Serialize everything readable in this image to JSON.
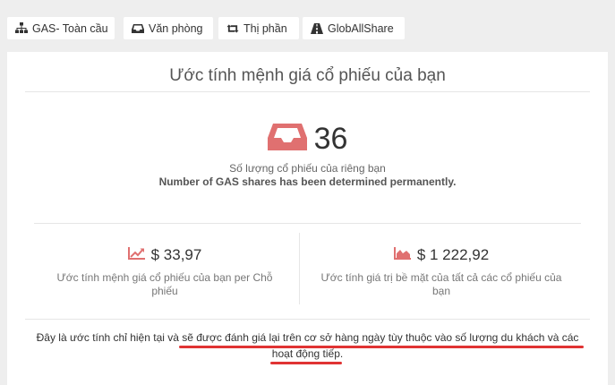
{
  "tabs": [
    {
      "label": "GAS- Toàn cầu",
      "icon": "sitemap-icon"
    },
    {
      "label": "Văn phòng",
      "icon": "inbox-icon"
    },
    {
      "label": "Thị phần",
      "icon": "retweet-icon"
    },
    {
      "label": "GlobAllShare",
      "icon": "road-icon"
    }
  ],
  "panel": {
    "title": "Ước tính mệnh giá cổ phiếu của bạn",
    "share_count": "36",
    "share_count_label": "Số lượng cổ phiếu của riêng bạn",
    "share_count_note": "Number of GAS shares has been determined permanently.",
    "stat_left": {
      "value": "$ 33,97",
      "label": "Ước tính mệnh giá cổ phiếu của bạn per Chỗ phiếu",
      "icon": "line-chart-icon"
    },
    "stat_right": {
      "value": "$ 1 222,92",
      "label": "Ước tính giá trị bề mặt của tất cả các cổ phiếu của bạn",
      "icon": "area-chart-icon"
    },
    "disclaimer": "Đây là ước tính chỉ hiện tại và sẽ được đánh giá lại trên cơ sở hàng ngày tùy thuộc vào số lượng du khách và các hoạt động tiếp."
  },
  "colors": {
    "accent": "#e07070",
    "annotation": "#e03333",
    "background": "#eeeeee"
  }
}
